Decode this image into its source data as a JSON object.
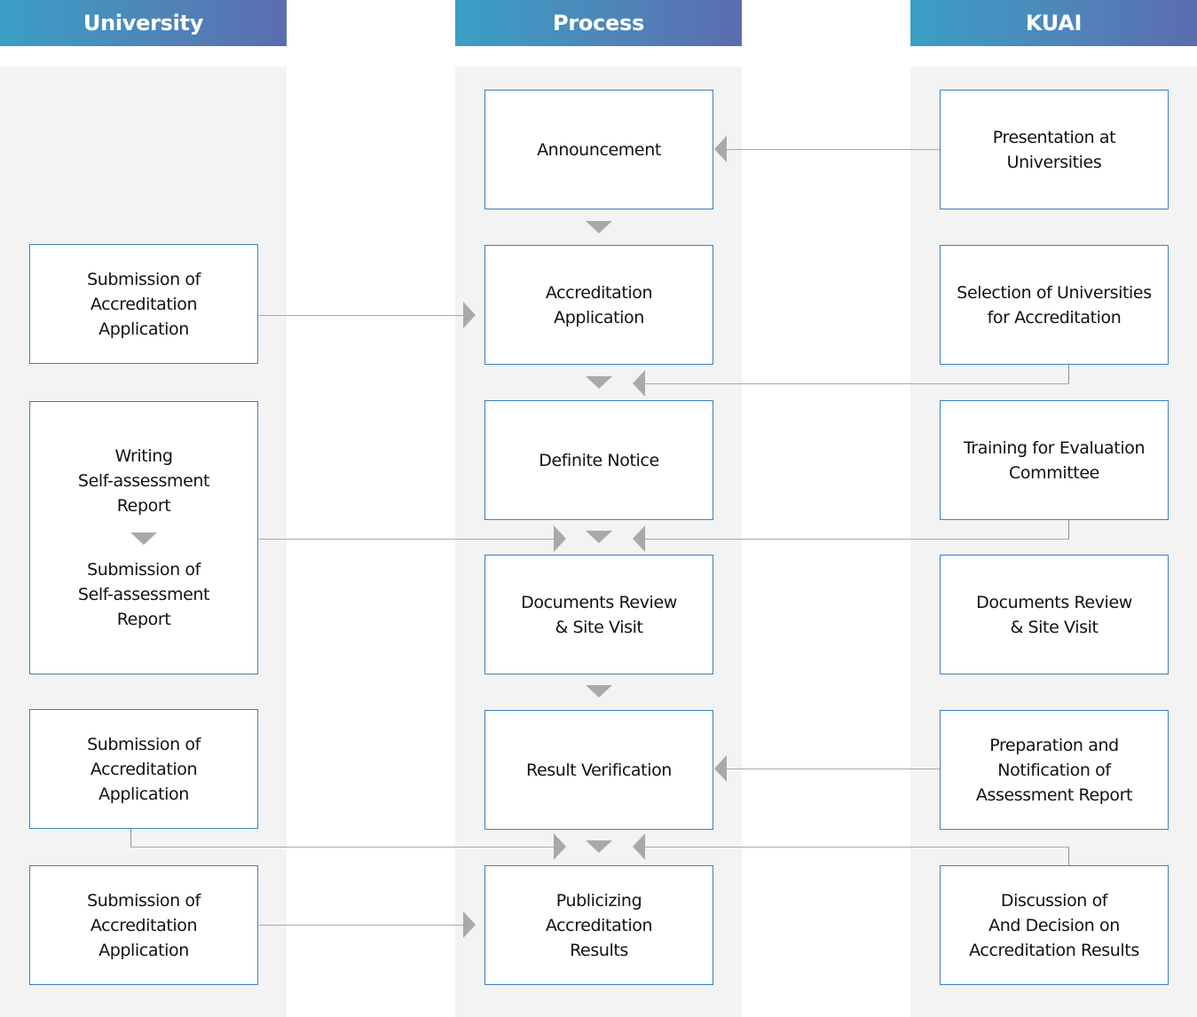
{
  "columns": {
    "university": "University",
    "process": "Process",
    "kuai": "KUAI"
  },
  "university_steps": [
    {
      "label": "Submission of\nAccreditation\nApplication"
    },
    {
      "label_top": "Writing\nSelf-assessment\nReport",
      "label_bottom": "Submission of\nSelf-assessment\nReport"
    },
    {
      "label": "Submission of\nAccreditation\nApplication"
    },
    {
      "label": "Submission of\nAccreditation\nApplication"
    }
  ],
  "process_steps": [
    {
      "label": "Announcement"
    },
    {
      "label": "Accreditation\nApplication"
    },
    {
      "label": "Definite Notice"
    },
    {
      "label": "Documents Review\n& Site Visit"
    },
    {
      "label": "Result Verification"
    },
    {
      "label": "Publicizing\nAccreditation\nResults"
    }
  ],
  "kuai_steps": [
    {
      "label": "Presentation at\nUniversities"
    },
    {
      "label": "Selection of Universities\nfor Accreditation"
    },
    {
      "label": "Training for Evaluation\nCommittee"
    },
    {
      "label": "Documents Review\n& Site Visit"
    },
    {
      "label": "Preparation and\nNotification of\nAssessment Report"
    },
    {
      "label": "Discussion of\nAnd Decision on\nAccreditation Results"
    }
  ],
  "colors": {
    "header_gradient_start": "#3a9fc6",
    "header_gradient_end": "#5b6cb0",
    "box_border": "#3a7fc4",
    "panel_bg": "#f3f3f3",
    "arrow": "#a9a9a9"
  }
}
